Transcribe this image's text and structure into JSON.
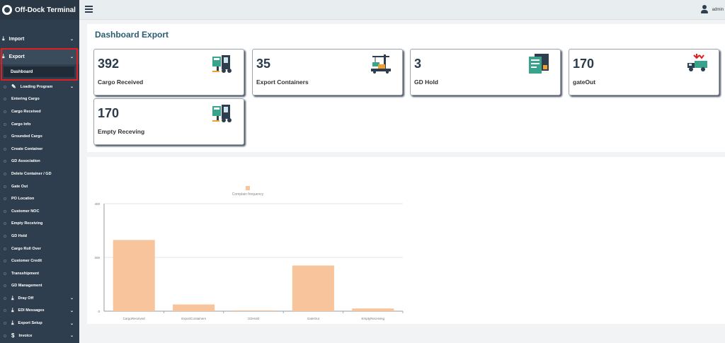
{
  "app": {
    "title": "Off-Dock Terminal"
  },
  "user": {
    "name": "admin"
  },
  "sidebar": {
    "import": "Import",
    "export": "Export",
    "dashboard": "Dashboard",
    "items": [
      {
        "label": "Loading Program",
        "group": true
      },
      {
        "label": "Entering Cargo"
      },
      {
        "label": "Cargo Received"
      },
      {
        "label": "Cargo Info"
      },
      {
        "label": "Grounded Cargo"
      },
      {
        "label": "Create Container"
      },
      {
        "label": "GD Association"
      },
      {
        "label": "Delete Container / GD"
      },
      {
        "label": "Gate Out"
      },
      {
        "label": "PO Location"
      },
      {
        "label": "Customer NOC"
      },
      {
        "label": "Empty Receiving"
      },
      {
        "label": "GD Hold"
      },
      {
        "label": "Cargo Roll Over"
      },
      {
        "label": "Customer Credit"
      },
      {
        "label": "Transshipment"
      },
      {
        "label": "GD Management"
      },
      {
        "label": "Dray Off",
        "group": true
      },
      {
        "label": "EDI Messages",
        "group": true
      },
      {
        "label": "Export Setup",
        "group": true
      },
      {
        "label": "Invoice",
        "group": true
      }
    ]
  },
  "page": {
    "title": "Dashboard Export"
  },
  "cards": [
    {
      "value": "392",
      "label": "Cargo Received",
      "icon": "forklift-icon"
    },
    {
      "value": "35",
      "label": "Export Containers",
      "icon": "crane-icon"
    },
    {
      "value": "3",
      "label": "GD Hold",
      "icon": "document-icon"
    },
    {
      "value": "170",
      "label": "gateOut",
      "icon": "truck-icon"
    },
    {
      "value": "170",
      "label": "Empty Receving",
      "icon": "forklift-icon"
    }
  ],
  "colors": {
    "sidebar": "#2e3e4e",
    "accent": "#e02020",
    "bar": "#f8c49c",
    "title": "#2b5d72"
  },
  "chart_data": {
    "type": "bar",
    "categories": [
      "CargoReceived",
      "ExportContainers",
      "GDHold",
      "GateOut",
      "EmptyReceiving"
    ],
    "series": [
      {
        "name": "Complain frequency",
        "values": [
          265,
          25,
          3,
          170,
          10
        ]
      }
    ],
    "yticks": [
      "0",
      "200",
      "400"
    ],
    "ylim": [
      0,
      400
    ],
    "grid": true,
    "legend": "top-center"
  }
}
